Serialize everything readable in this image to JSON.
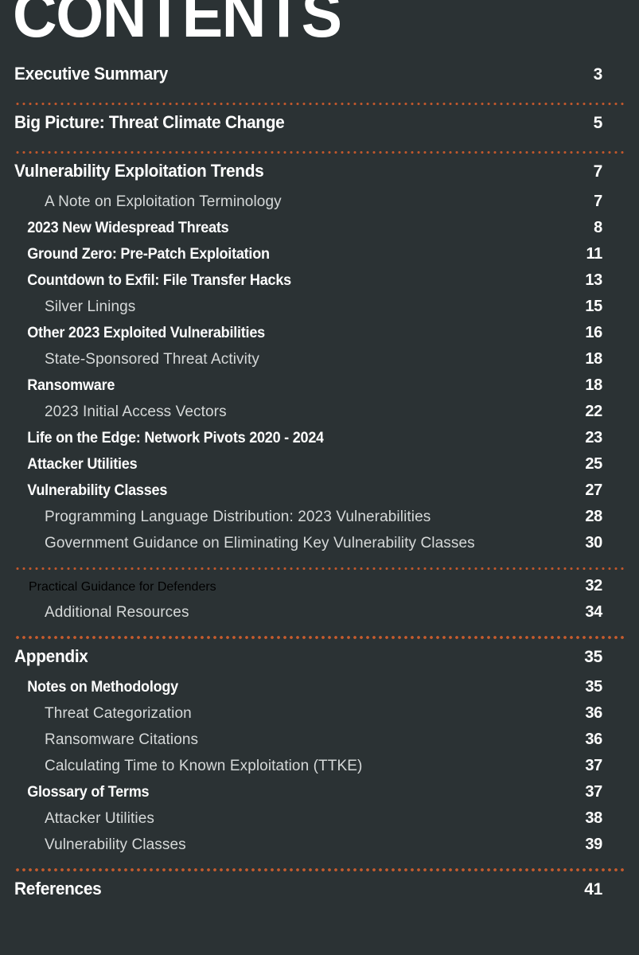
{
  "document": {
    "title": "CONTENTS",
    "background_color": "#2b3234",
    "divider_color": "#c0572c",
    "text_color_primary": "#ffffff",
    "text_color_secondary": "#d6d9d9"
  },
  "entries": [
    {
      "type": "entry",
      "level": 1,
      "label": "Executive Summary",
      "page": "3"
    },
    {
      "type": "divider"
    },
    {
      "type": "entry",
      "level": 1,
      "label": "Big Picture: Threat Climate Change",
      "page": "5"
    },
    {
      "type": "divider"
    },
    {
      "type": "entry",
      "level": 1,
      "label": "Vulnerability Exploitation Trends",
      "page": "7"
    },
    {
      "type": "entry",
      "level": 3,
      "label": "A Note on Exploitation Terminology",
      "page": "7"
    },
    {
      "type": "entry",
      "level": 2,
      "label": "2023 New Widespread Threats",
      "page": "8"
    },
    {
      "type": "entry",
      "level": 2,
      "label": "Ground Zero: Pre-Patch Exploitation",
      "page": "11"
    },
    {
      "type": "entry",
      "level": 2,
      "label": "Countdown to Exfil: File Transfer Hacks",
      "page": "13"
    },
    {
      "type": "entry",
      "level": 3,
      "label": "Silver Linings",
      "page": "15"
    },
    {
      "type": "entry",
      "level": 2,
      "label": "Other 2023 Exploited Vulnerabilities",
      "page": "16"
    },
    {
      "type": "entry",
      "level": 3,
      "label": "State-Sponsored Threat Activity",
      "page": "18"
    },
    {
      "type": "entry",
      "level": 2,
      "label": "Ransomware",
      "page": "18"
    },
    {
      "type": "entry",
      "level": 3,
      "label": "2023 Initial Access Vectors",
      "page": "22"
    },
    {
      "type": "entry",
      "level": 2,
      "label": "Life on the Edge: Network Pivots 2020 - 2024",
      "page": "23"
    },
    {
      "type": "entry",
      "level": 2,
      "label": "Attacker Utilities",
      "page": "25"
    },
    {
      "type": "entry",
      "level": 2,
      "label": "Vulnerability Classes",
      "page": "27"
    },
    {
      "type": "entry",
      "level": 3,
      "label": "Programming Language Distribution: 2023 Vulnerabilities",
      "page": "28"
    },
    {
      "type": "entry",
      "level": 3,
      "label": "Government Guidance on Eliminating Key Vulnerability Classes",
      "page": "30"
    },
    {
      "type": "divider"
    },
    {
      "type": "entry",
      "level": "1b",
      "label": "Practical Guidance for Defenders",
      "page": "32"
    },
    {
      "type": "entry",
      "level": 3,
      "label": "Additional Resources",
      "page": "34"
    },
    {
      "type": "divider",
      "thick": true
    },
    {
      "type": "entry",
      "level": 1,
      "label": "Appendix",
      "page": "35"
    },
    {
      "type": "entry",
      "level": 2,
      "label": "Notes on Methodology",
      "page": "35"
    },
    {
      "type": "entry",
      "level": 3,
      "label": "Threat Categorization",
      "page": "36"
    },
    {
      "type": "entry",
      "level": 3,
      "label": "Ransomware Citations",
      "page": "36"
    },
    {
      "type": "entry",
      "level": 3,
      "label": "Calculating Time to Known Exploitation (TTKE)",
      "page": "37"
    },
    {
      "type": "entry",
      "level": 2,
      "label": "Glossary of Terms",
      "page": "37"
    },
    {
      "type": "entry",
      "level": 3,
      "label": "Attacker Utilities",
      "page": "38"
    },
    {
      "type": "entry",
      "level": 3,
      "label": "Vulnerability Classes",
      "page": "39"
    },
    {
      "type": "divider",
      "thick": true
    },
    {
      "type": "entry",
      "level": 1,
      "label": "References",
      "page": "41"
    }
  ]
}
